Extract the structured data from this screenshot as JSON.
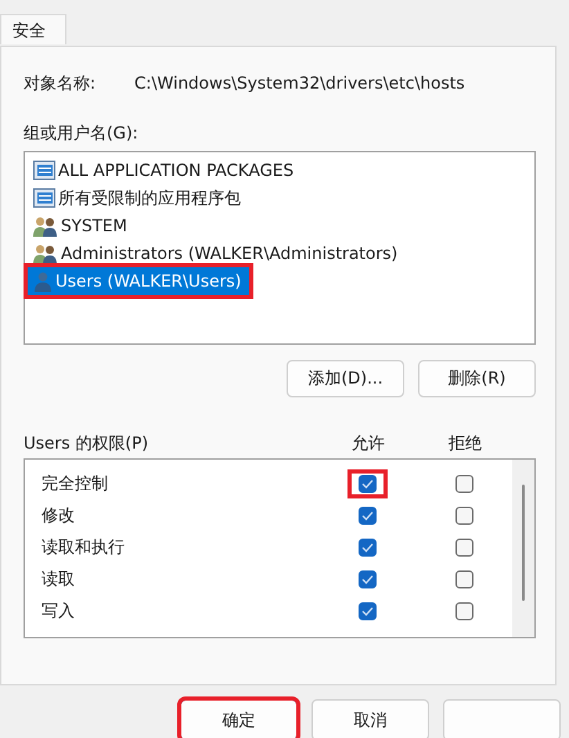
{
  "tabs": [
    {
      "label": "安全",
      "selected": true
    }
  ],
  "object_name": {
    "label": "对象名称:",
    "value": "C:\\Windows\\System32\\drivers\\etc\\hosts"
  },
  "groups": {
    "label": "组或用户名(G):",
    "items": [
      {
        "kind": "package",
        "name": "ALL APPLICATION PACKAGES",
        "selected": false,
        "annotated": false
      },
      {
        "kind": "package",
        "name": "所有受限制的应用程序包",
        "selected": false,
        "annotated": false
      },
      {
        "kind": "group",
        "name": "SYSTEM",
        "selected": false,
        "annotated": false
      },
      {
        "kind": "group",
        "name": "Administrators (WALKER\\Administrators)",
        "selected": false,
        "annotated": false
      },
      {
        "kind": "user",
        "name": "Users (WALKER\\Users)",
        "selected": true,
        "annotated": true
      }
    ]
  },
  "group_buttons": [
    "添加(D)...",
    "删除(R)"
  ],
  "permissions": {
    "label": "Users 的权限(P)",
    "allow_header": "允许",
    "deny_header": "拒绝",
    "rows": [
      {
        "name": "完全控制",
        "allow": true,
        "deny": false,
        "annotated": true
      },
      {
        "name": "修改",
        "allow": true,
        "deny": false,
        "annotated": false
      },
      {
        "name": "读取和执行",
        "allow": true,
        "deny": false,
        "annotated": false
      },
      {
        "name": "读取",
        "allow": true,
        "deny": false,
        "annotated": false
      },
      {
        "name": "写入",
        "allow": true,
        "deny": false,
        "annotated": false
      }
    ]
  },
  "dialog_buttons": [
    {
      "label": "确定",
      "annotated": true
    },
    {
      "label": "取消",
      "annotated": false
    },
    {
      "annotated": false
    }
  ]
}
